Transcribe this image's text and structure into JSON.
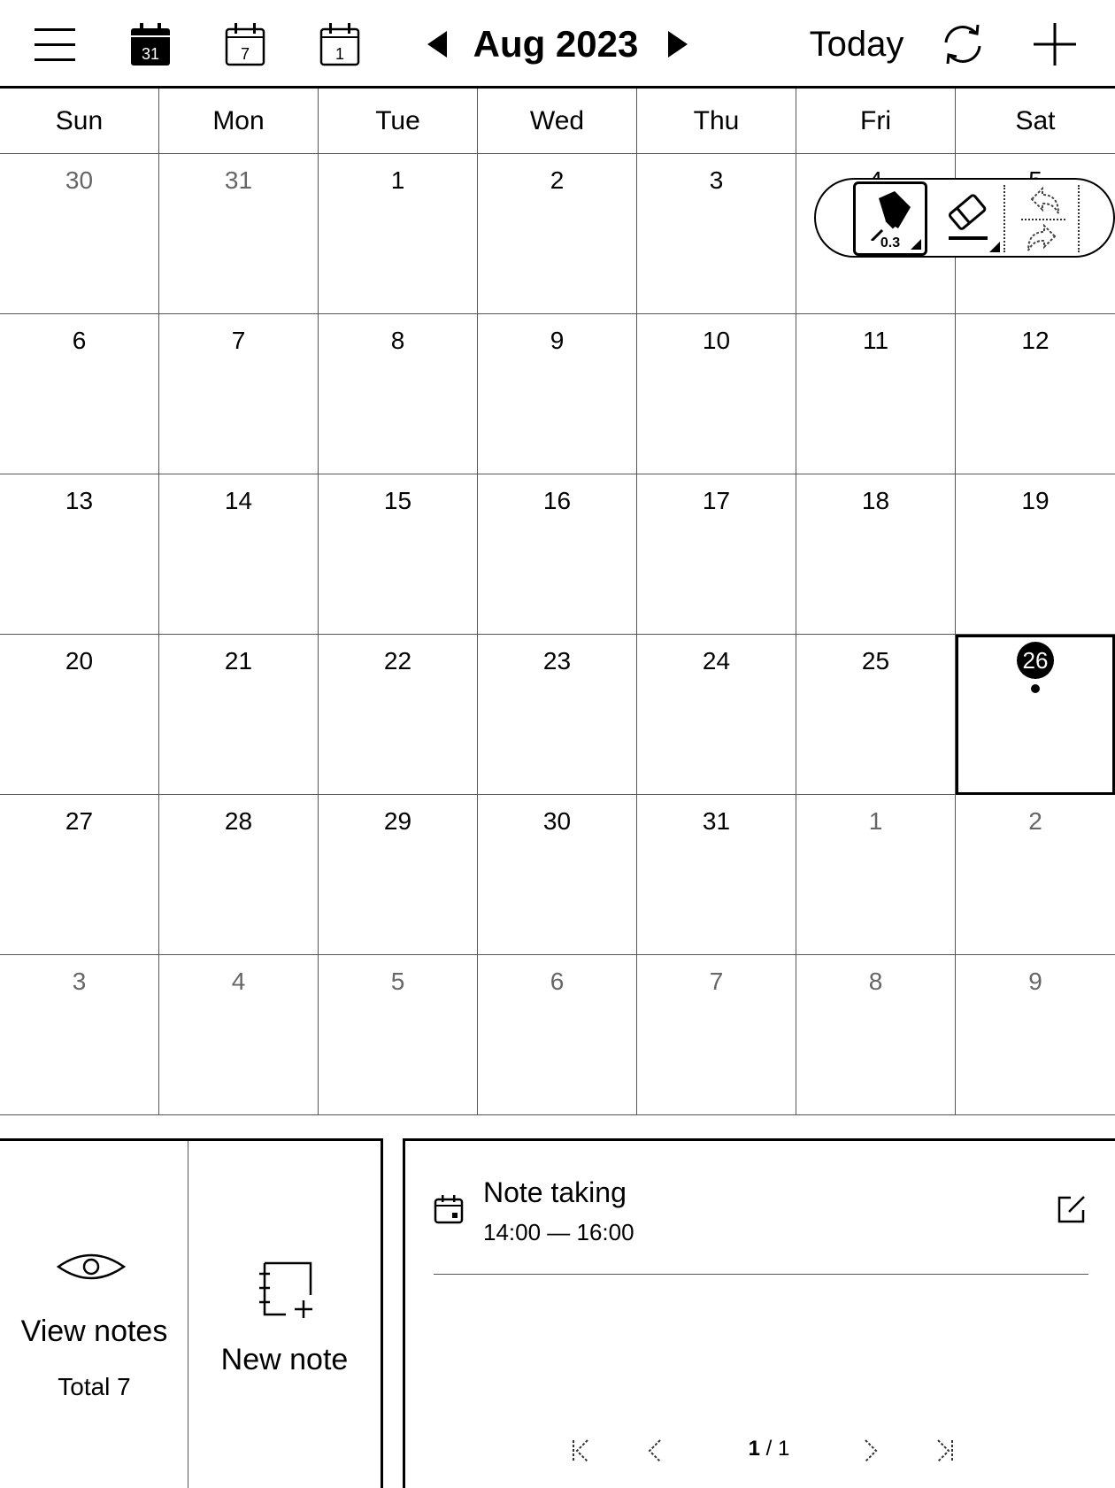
{
  "toolbar": {
    "menu_icon": "hamburger-menu-icon",
    "month_view_icon": "calendar-month-icon",
    "month_view_number": "31",
    "week_view_icon": "calendar-week-icon",
    "week_view_number": "7",
    "day_view_icon": "calendar-day-icon",
    "day_view_number": "1",
    "title": "Aug 2023",
    "today_label": "Today",
    "sync_icon": "sync-icon",
    "add_icon": "plus-icon"
  },
  "weekdays": [
    "Sun",
    "Mon",
    "Tue",
    "Wed",
    "Thu",
    "Fri",
    "Sat"
  ],
  "calendar": {
    "today": "26",
    "days": [
      {
        "n": "30",
        "other": true
      },
      {
        "n": "31",
        "other": true
      },
      {
        "n": "1"
      },
      {
        "n": "2"
      },
      {
        "n": "3"
      },
      {
        "n": "4"
      },
      {
        "n": "5"
      },
      {
        "n": "6"
      },
      {
        "n": "7"
      },
      {
        "n": "8"
      },
      {
        "n": "9"
      },
      {
        "n": "10"
      },
      {
        "n": "11"
      },
      {
        "n": "12"
      },
      {
        "n": "13"
      },
      {
        "n": "14"
      },
      {
        "n": "15"
      },
      {
        "n": "16"
      },
      {
        "n": "17"
      },
      {
        "n": "18"
      },
      {
        "n": "19"
      },
      {
        "n": "20"
      },
      {
        "n": "21"
      },
      {
        "n": "22"
      },
      {
        "n": "23"
      },
      {
        "n": "24"
      },
      {
        "n": "25"
      },
      {
        "n": "26",
        "today": true,
        "has_event": true
      },
      {
        "n": "27"
      },
      {
        "n": "28"
      },
      {
        "n": "29"
      },
      {
        "n": "30"
      },
      {
        "n": "31"
      },
      {
        "n": "1",
        "other": true
      },
      {
        "n": "2",
        "other": true
      },
      {
        "n": "3",
        "other": true
      },
      {
        "n": "4",
        "other": true
      },
      {
        "n": "5",
        "other": true
      },
      {
        "n": "6",
        "other": true
      },
      {
        "n": "7",
        "other": true
      },
      {
        "n": "8",
        "other": true
      },
      {
        "n": "9",
        "other": true
      }
    ]
  },
  "pen_toolbar": {
    "pen_icon": "marker-pen-icon",
    "pen_size": "0.3",
    "eraser_icon": "eraser-icon",
    "undo_icon": "undo-icon",
    "redo_icon": "redo-icon"
  },
  "notes": {
    "view_icon": "eye-icon",
    "view_label": "View notes",
    "total_label": "Total 7",
    "new_icon": "new-notebook-icon",
    "new_label": "New note"
  },
  "event": {
    "icon": "calendar-event-icon",
    "title": "Note taking",
    "time": "14:00 — 16:00",
    "edit_icon": "edit-icon"
  },
  "pager": {
    "current": "1",
    "separator": "/",
    "total": "1"
  }
}
